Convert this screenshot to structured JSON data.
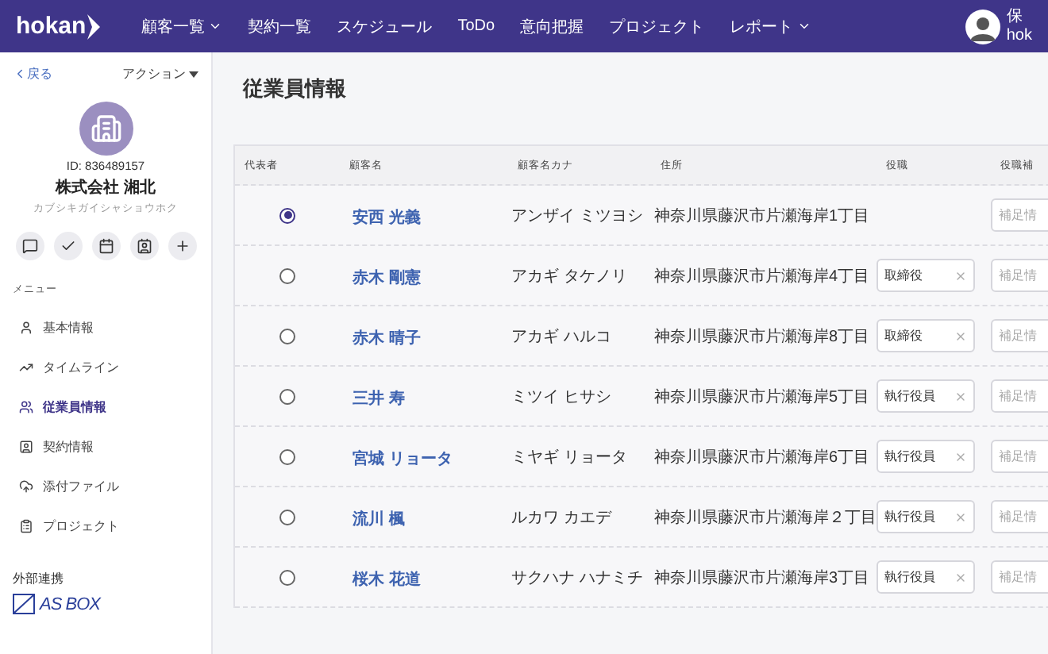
{
  "nav": {
    "logo": "hokan",
    "items": [
      {
        "label": "顧客一覧",
        "dropdown": true
      },
      {
        "label": "契約一覧",
        "dropdown": false
      },
      {
        "label": "スケジュール",
        "dropdown": false
      },
      {
        "label": "ToDo",
        "dropdown": false
      },
      {
        "label": "意向把握",
        "dropdown": false
      },
      {
        "label": "プロジェクト",
        "dropdown": false
      },
      {
        "label": "レポート",
        "dropdown": true
      }
    ],
    "user_lines": [
      "保",
      "hok"
    ]
  },
  "sidebar": {
    "back": "戻る",
    "action": "アクション",
    "customer": {
      "id": "ID: 836489157",
      "name": "株式会社 湘北",
      "kana": "カブシキガイシャショウホク"
    },
    "menu_label": "メニュー",
    "menu": [
      {
        "label": "基本情報",
        "selected": false
      },
      {
        "label": "タイムライン",
        "selected": false
      },
      {
        "label": "従業員情報",
        "selected": true
      },
      {
        "label": "契約情報",
        "selected": false
      },
      {
        "label": "添付ファイル",
        "selected": false
      },
      {
        "label": "プロジェクト",
        "selected": false
      }
    ],
    "external_label": "外部連携",
    "external_logo": "AS BOX"
  },
  "page_title": "従業員情報",
  "table": {
    "columns": [
      "代表者",
      "顧客名",
      "顧客名カナ",
      "住所",
      "役職",
      "役職補"
    ],
    "rows": [
      {
        "representative": true,
        "name": "安西 光義",
        "kana": "アンザイ ミツヨシ",
        "address": "神奈川県藤沢市片瀬海岸1丁目",
        "supplement_placeholder": "補足情"
      },
      {
        "representative": false,
        "name": "赤木 剛憲",
        "kana": "アカギ タケノリ",
        "address": "神奈川県藤沢市片瀬海岸4丁目",
        "role": "取締役",
        "supplement_placeholder": "補足情"
      },
      {
        "representative": false,
        "name": "赤木 晴子",
        "kana": "アカギ ハルコ",
        "address": "神奈川県藤沢市片瀬海岸8丁目",
        "role": "取締役",
        "supplement_placeholder": "補足情"
      },
      {
        "representative": false,
        "name": "三井 寿",
        "kana": "ミツイ ヒサシ",
        "address": "神奈川県藤沢市片瀬海岸5丁目",
        "role": "執行役員",
        "supplement_placeholder": "補足情"
      },
      {
        "representative": false,
        "name": "宮城 リョータ",
        "kana": "ミヤギ リョータ",
        "address": "神奈川県藤沢市片瀬海岸6丁目",
        "role": "執行役員",
        "supplement_placeholder": "補足情"
      },
      {
        "representative": false,
        "name": "流川 楓",
        "kana": "ルカワ カエデ",
        "address": "神奈川県藤沢市片瀬海岸２丁目",
        "role": "執行役員",
        "supplement_placeholder": "補足情"
      },
      {
        "representative": false,
        "name": "桜木 花道",
        "kana": "サクハナ ハナミチ",
        "address": "神奈川県藤沢市片瀬海岸3丁目",
        "role": "執行役員",
        "supplement_placeholder": "補足情"
      }
    ]
  }
}
